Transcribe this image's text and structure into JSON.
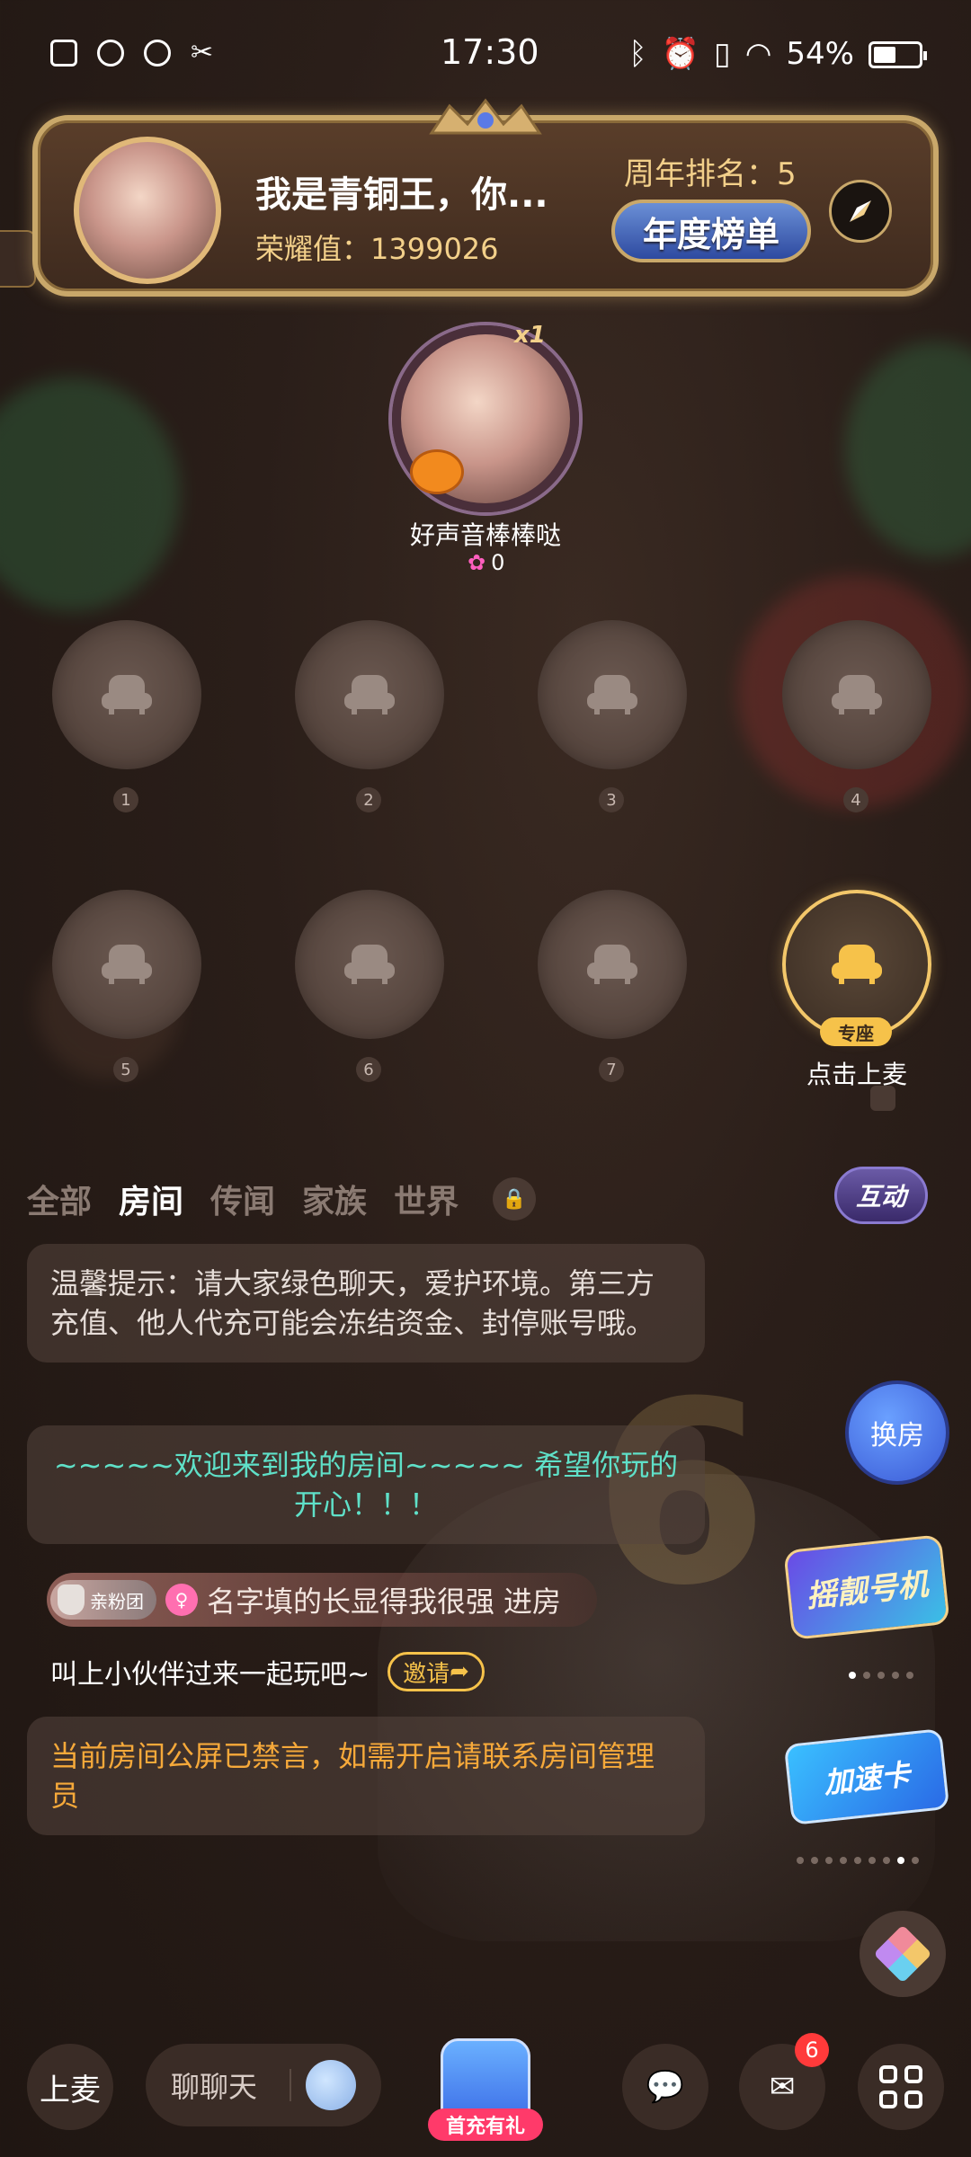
{
  "status_bar": {
    "time": "17:30",
    "battery": "54%",
    "left_icons": [
      "notification-icon",
      "play-icon",
      "cloud-icon",
      "tools-icon"
    ],
    "right_icons": [
      "bluetooth-icon",
      "alarm-icon",
      "vibrate-icon",
      "wifi-icon"
    ]
  },
  "banner": {
    "name": "我是青铜王，你...",
    "honor_value": "荣耀值：1399026",
    "anniversary_rank": "周年排名：5",
    "annual_board_label": "年度榜单"
  },
  "host": {
    "name": "好声音棒棒哒",
    "multiplier": "x1",
    "score": "0"
  },
  "seats": [
    {
      "number": "1"
    },
    {
      "number": "2"
    },
    {
      "number": "3"
    },
    {
      "number": "4"
    },
    {
      "number": "5"
    },
    {
      "number": "6"
    },
    {
      "number": "7"
    }
  ],
  "vip_seat": {
    "badge": "专座",
    "label": "点击上麦"
  },
  "tabs": [
    {
      "label": "全部",
      "active": false
    },
    {
      "label": "房间",
      "active": true
    },
    {
      "label": "传闻",
      "active": false
    },
    {
      "label": "家族",
      "active": false
    },
    {
      "label": "世界",
      "active": false
    }
  ],
  "interact_label": "互动",
  "messages": {
    "notice": "温馨提示：请大家绿色聊天，爱护环境。第三方充值、他人代充可能会冻结资金、封停账号哦。",
    "welcome": "~~~~~欢迎来到我的房间~~~~~ 希望你玩的开心！！！",
    "entry_badge": "亲粉团",
    "entry_user": "名字填的长显得我很强",
    "entry_action": "进房",
    "invite_text": "叫上小伙伴过来一起玩吧~",
    "invite_button": "邀请",
    "mute_notice": "当前房间公屏已禁言，如需开启请联系房间管理员"
  },
  "floaters": {
    "swap_room": "换房",
    "promo1": "摇靓号机",
    "promo2": "加速卡"
  },
  "bottom_bar": {
    "mic_label": "上麦",
    "chat_placeholder": "聊聊天",
    "gift_tag": "首充有礼",
    "message_badge": "6"
  },
  "colors": {
    "background": "#2a1e19",
    "gold": "#f3d08a",
    "teal": "#5fe0c8",
    "orange": "#f6a93a",
    "vip_gold": "#f6c24a"
  }
}
